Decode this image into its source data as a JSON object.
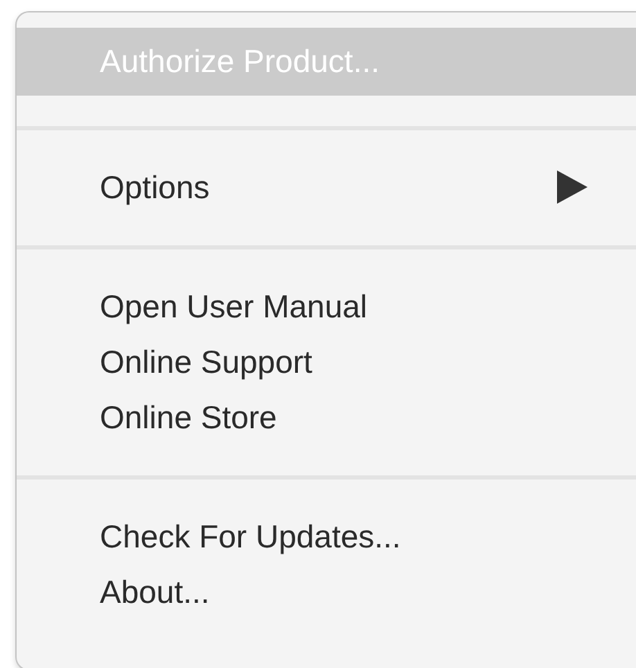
{
  "menu": {
    "sections": [
      {
        "items": [
          {
            "label": "Authorize Product...",
            "selected": true,
            "submenu": false
          }
        ]
      },
      {
        "items": [
          {
            "label": "Options",
            "selected": false,
            "submenu": true
          }
        ]
      },
      {
        "items": [
          {
            "label": "Open User Manual",
            "selected": false,
            "submenu": false
          },
          {
            "label": "Online Support",
            "selected": false,
            "submenu": false
          },
          {
            "label": "Online Store",
            "selected": false,
            "submenu": false
          }
        ]
      },
      {
        "items": [
          {
            "label": "Check For Updates...",
            "selected": false,
            "submenu": false
          },
          {
            "label": "About...",
            "selected": false,
            "submenu": false
          }
        ]
      }
    ]
  }
}
